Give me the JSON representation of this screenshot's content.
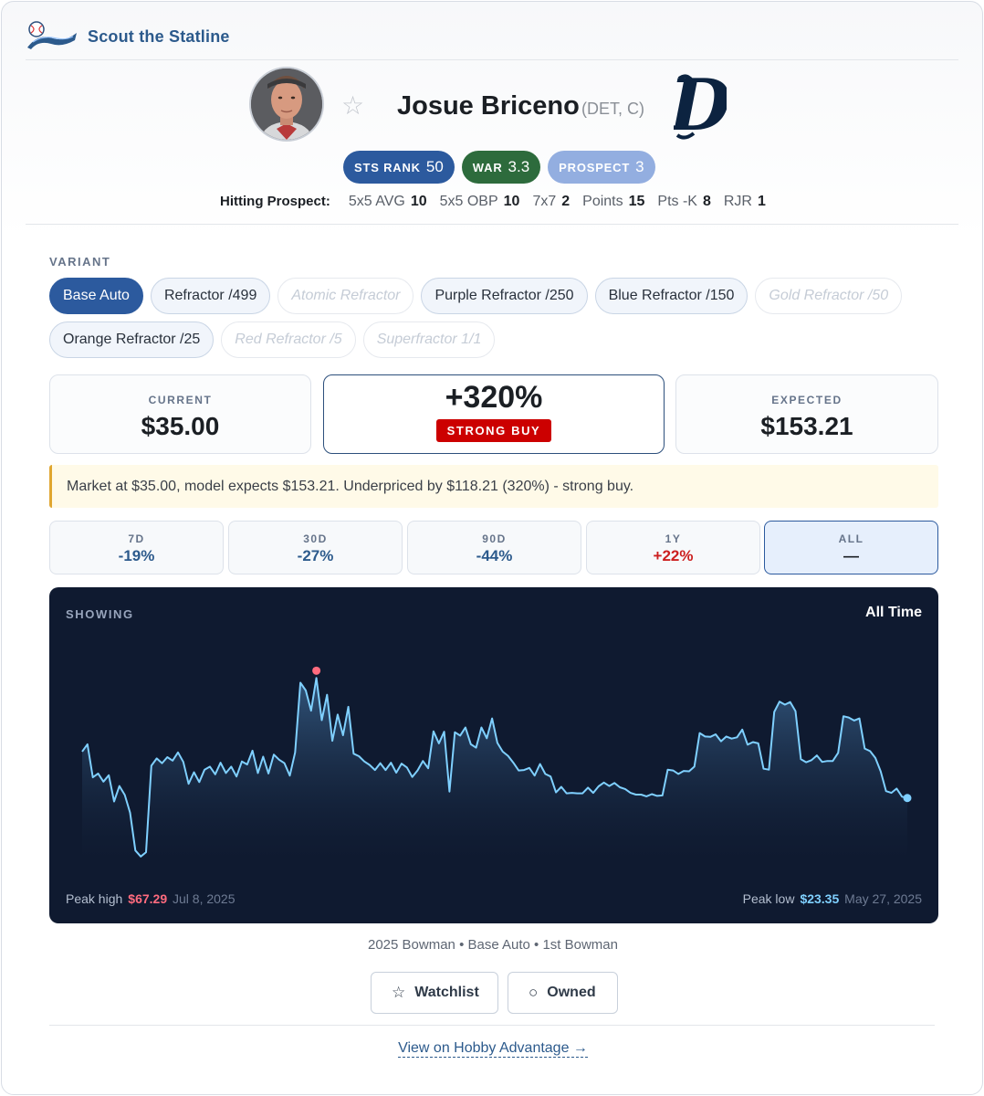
{
  "brand": {
    "name": "Scout the Statline",
    "logo_icon": "baseball-script-logo"
  },
  "player": {
    "name": "Josue Briceno",
    "meta": "(DET, C)",
    "team_logo_icon": "detroit-old-english-d-logo",
    "favorite_icon": "☆"
  },
  "badges": [
    {
      "label": "STS RANK",
      "value": "50",
      "color": "#2c5a9e"
    },
    {
      "label": "WAR",
      "value": "3.3",
      "color": "#2d6b3c"
    },
    {
      "label": "PROSPECT",
      "value": "3",
      "color": "#93aee0"
    }
  ],
  "hitting": {
    "label": "Hitting Prospect:",
    "stats": [
      {
        "name": "5x5 AVG",
        "value": "10"
      },
      {
        "name": "5x5 OBP",
        "value": "10"
      },
      {
        "name": "7x7",
        "value": "2"
      },
      {
        "name": "Points",
        "value": "15"
      },
      {
        "name": "Pts -K",
        "value": "8"
      },
      {
        "name": "RJR",
        "value": "1"
      }
    ]
  },
  "variant": {
    "label": "VARIANT",
    "options": [
      {
        "label": "Base Auto",
        "state": "active"
      },
      {
        "label": "Refractor /499",
        "state": "normal"
      },
      {
        "label": "Atomic Refractor",
        "state": "disabled"
      },
      {
        "label": "Purple Refractor /250",
        "state": "normal"
      },
      {
        "label": "Blue Refractor /150",
        "state": "normal"
      },
      {
        "label": "Gold Refractor /50",
        "state": "disabled"
      },
      {
        "label": "Orange Refractor /25",
        "state": "normal"
      },
      {
        "label": "Red Refractor /5",
        "state": "disabled"
      },
      {
        "label": "Superfractor 1/1",
        "state": "disabled"
      }
    ]
  },
  "pricing": {
    "current_label": "CURRENT",
    "current_value": "$35.00",
    "signal_pct": "+320%",
    "signal_tag": "STRONG BUY",
    "expected_label": "EXPECTED",
    "expected_value": "$153.21"
  },
  "note": "Market at $35.00, model expects $153.21. Underpriced by $118.21 (320%) - strong buy.",
  "timeframes": [
    {
      "label": "7D",
      "value": "-19%",
      "direction": "down",
      "active": false
    },
    {
      "label": "30D",
      "value": "-27%",
      "direction": "down",
      "active": false
    },
    {
      "label": "90D",
      "value": "-44%",
      "direction": "down",
      "active": false
    },
    {
      "label": "1Y",
      "value": "+22%",
      "direction": "up",
      "active": false
    },
    {
      "label": "ALL",
      "value": "—",
      "direction": "none",
      "active": true
    }
  ],
  "chart": {
    "showing_label": "SHOWING",
    "range_label": "All Time",
    "peak_high_label": "Peak high",
    "peak_high_value": "$67.29",
    "peak_high_date": "Jul 8, 2025",
    "peak_low_label": "Peak low",
    "peak_low_value": "$23.35",
    "peak_low_date": "May 27, 2025",
    "line_color": "#7fd0ff",
    "high_marker_color": "#ff6b7e"
  },
  "chart_data": {
    "type": "area",
    "title": "",
    "xlabel": "",
    "ylabel": "",
    "ylim": [
      23,
      68
    ],
    "series": [
      {
        "values": [
          48.5,
          50.2,
          42.5,
          43.4,
          41.5,
          43.0,
          36.9,
          40.5,
          38.4,
          34.3,
          25.5,
          24.1,
          25.1,
          45.2,
          46.9,
          45.8,
          47.2,
          46.4,
          48.3,
          46.1,
          41.0,
          43.7,
          41.4,
          44.3,
          45.0,
          43.2,
          45.9,
          43.5,
          45.0,
          42.7,
          46.2,
          45.5,
          48.7,
          43.5,
          47.3,
          43.4,
          47.8,
          46.6,
          45.8,
          42.9,
          48.3,
          64.5,
          62.7,
          58.0,
          65.6,
          55.8,
          61.7,
          51.0,
          57.1,
          52.3,
          58.9,
          48.0,
          47.4,
          46.2,
          45.4,
          44.2,
          45.8,
          44.2,
          45.9,
          43.6,
          45.7,
          44.8,
          42.6,
          44.1,
          46.3,
          44.6,
          53.2,
          50.4,
          53.1,
          39.2,
          53.0,
          52.2,
          54.1,
          50.2,
          49.4,
          54.1,
          51.6,
          56.2,
          50.5,
          48.5,
          47.5,
          45.9,
          44.1,
          44.2,
          44.7,
          42.9,
          45.6,
          43.3,
          42.7,
          39.0,
          40.3,
          38.8,
          38.9,
          38.8,
          38.8,
          40.1,
          38.9,
          40.4,
          41.3,
          40.5,
          41.2,
          40.2,
          39.8,
          38.9,
          38.5,
          38.5,
          38.1,
          38.6,
          38.2,
          38.3,
          44.3,
          44.1,
          43.3,
          44.0,
          43.9,
          45.0,
          52.8,
          52.0,
          51.9,
          52.5,
          50.9,
          52.0,
          51.5,
          51.8,
          53.6,
          50.1,
          50.7,
          50.4,
          44.5,
          44.3,
          57.7,
          60.1,
          59.4,
          60.0,
          57.9,
          46.7,
          46.0,
          46.5,
          47.6,
          46.1,
          46.3,
          46.3,
          48.2,
          56.7,
          56.4,
          55.7,
          56.2,
          49.2,
          48.6,
          47.0,
          43.9,
          39.3,
          38.9,
          39.9,
          38.0,
          37.7
        ]
      }
    ],
    "peak_high": {
      "date": "Jul 8, 2025",
      "value": 67.29
    },
    "peak_low": {
      "date": "May 27, 2025",
      "value": 23.35
    },
    "grid": false,
    "legend": "none"
  },
  "card_caption": "2025 Bowman • Base Auto • 1st Bowman",
  "actions": {
    "watchlist_label": "Watchlist",
    "watchlist_icon": "☆",
    "owned_label": "Owned",
    "owned_icon": "○"
  },
  "footer_link": "View on Hobby Advantage →"
}
